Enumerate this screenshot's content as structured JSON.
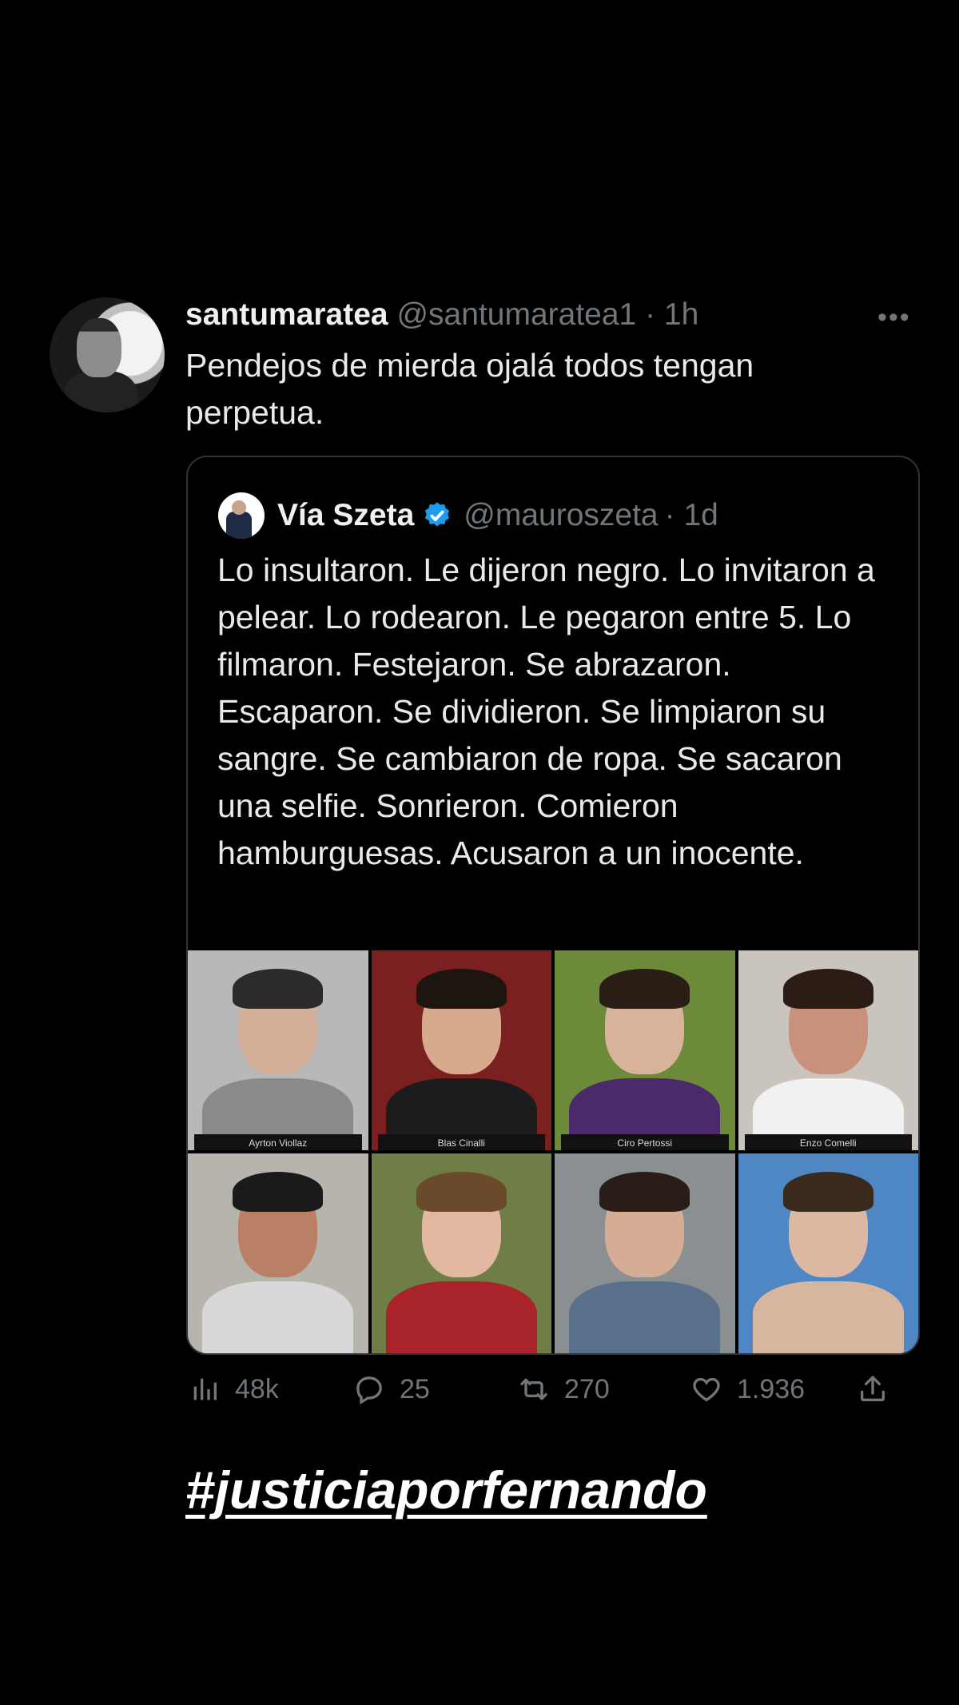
{
  "tweet": {
    "display_name": "santumaratea",
    "handle": "@santumaratea1",
    "time": "· 1h",
    "text": "Pendejos de mierda ojalá todos tengan perpetua."
  },
  "quoted": {
    "display_name": "Vía Szeta",
    "handle": "@mauroszeta",
    "time": "· 1d",
    "text": "Lo insultaron. Le dijeron negro. Lo invitaron a pelear. Lo rodearon. Le pegaron entre 5. Lo filmaron. Festejaron. Se abrazaron. Escaparon. Se dividieron. Se limpiaron su sangre. Se cambiaron de ropa. Se sacaron una selfie. Sonrieron. Comieron hamburguesas. Acusaron a un inocente.",
    "photos": [
      {
        "caption": "Ayrton Viollaz",
        "bg": "#b8b8b8",
        "skin": "#d4b09a",
        "hair": "#2b2b2b",
        "shirt": "#8a8a8a"
      },
      {
        "caption": "Blas Cinalli",
        "bg": "#7a2020",
        "skin": "#d7a98d",
        "hair": "#1d1510",
        "shirt": "#1c1c1c"
      },
      {
        "caption": "Ciro Pertossi",
        "bg": "#6c8a3a",
        "skin": "#d9b29a",
        "hair": "#2a1e16",
        "shirt": "#4b2a6b"
      },
      {
        "caption": "Enzo Comelli",
        "bg": "#c9c4bd",
        "skin": "#c9917a",
        "hair": "#2b1d15",
        "shirt": "#f1f1f1"
      },
      {
        "caption": "",
        "bg": "#b7b4ae",
        "skin": "#b98066",
        "hair": "#1a1a1a",
        "shirt": "#d8d8d8"
      },
      {
        "caption": "",
        "bg": "#6f7d46",
        "skin": "#e2b9a0",
        "hair": "#6a4a2a",
        "shirt": "#a8242a"
      },
      {
        "caption": "",
        "bg": "#8a8f92",
        "skin": "#d5ac94",
        "hair": "#2a1d18",
        "shirt": "#5a6f8a"
      },
      {
        "caption": "",
        "bg": "#4f86c4",
        "skin": "#dcb8a2",
        "hair": "#3a2a1c",
        "shirt": "#d7b6a0"
      }
    ]
  },
  "metrics": {
    "views": "48k",
    "replies": "25",
    "retweets": "270",
    "likes": "1.936"
  },
  "hashtag": "#justiciaporfernando",
  "colors": {
    "background": "#000000",
    "text": "#e7e9ea",
    "muted": "#71767b",
    "verified": "#1d9bf0",
    "border": "#2f3336"
  }
}
